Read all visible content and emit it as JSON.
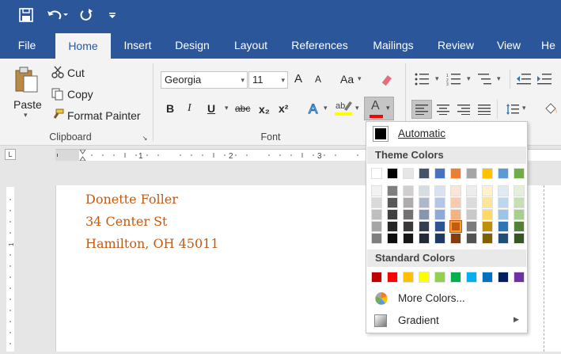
{
  "qat": {
    "icons": [
      "save-icon",
      "undo-icon",
      "redo-icon",
      "customize-icon"
    ]
  },
  "tabs": [
    {
      "label": "File"
    },
    {
      "label": "Home"
    },
    {
      "label": "Insert"
    },
    {
      "label": "Design"
    },
    {
      "label": "Layout"
    },
    {
      "label": "References"
    },
    {
      "label": "Mailings"
    },
    {
      "label": "Review"
    },
    {
      "label": "View"
    },
    {
      "label": "He"
    }
  ],
  "clipboard": {
    "paste": "Paste",
    "cut": "Cut",
    "copy": "Copy",
    "format_painter": "Format Painter",
    "group_label": "Clipboard"
  },
  "font": {
    "name": "Georgia",
    "size": "11",
    "group_label": "Font",
    "change_case": "Aa",
    "bold": "B",
    "italic": "I",
    "underline": "U",
    "strike": "abc",
    "subscript": "x₂",
    "superscript": "x²",
    "font_color_letter": "A",
    "grow": "A",
    "shrink": "A"
  },
  "paragraph": {
    "group_label": ""
  },
  "document": {
    "lines": [
      "Donette Foller",
      "34 Center St",
      "Hamilton, OH 45011"
    ]
  },
  "color_menu": {
    "automatic": "Automatic",
    "theme_header": "Theme Colors",
    "standard_header": "Standard Colors",
    "more_colors": "More Colors...",
    "gradient": "Gradient",
    "theme_top": [
      "#ffffff",
      "#000000",
      "#e7e6e6",
      "#44546a",
      "#4472c4",
      "#ed7d31",
      "#a5a5a5",
      "#ffc000",
      "#5b9bd5",
      "#70ad47"
    ],
    "theme_shades": [
      [
        "#f2f2f2",
        "#d9d9d9",
        "#bfbfbf",
        "#a6a6a6",
        "#7f7f7f"
      ],
      [
        "#7f7f7f",
        "#595959",
        "#404040",
        "#262626",
        "#0d0d0d"
      ],
      [
        "#d0cece",
        "#aeabab",
        "#767171",
        "#3a3838",
        "#171616"
      ],
      [
        "#d6dce4",
        "#adb9ca",
        "#8497b0",
        "#333f4f",
        "#222a35"
      ],
      [
        "#d9e2f3",
        "#b4c6e7",
        "#8eaadb",
        "#2f5496",
        "#1f3864"
      ],
      [
        "#fbe5d5",
        "#f7caac",
        "#f4b183",
        "#c55a11",
        "#833c0b"
      ],
      [
        "#ededed",
        "#dbdbdb",
        "#c9c9c9",
        "#7b7b7b",
        "#525252"
      ],
      [
        "#fff2cc",
        "#fee599",
        "#ffd966",
        "#bf8f00",
        "#7f6000"
      ],
      [
        "#deebf6",
        "#bdd7ee",
        "#9dc3e6",
        "#2e75b5",
        "#1f4e79"
      ],
      [
        "#e2efd9",
        "#c5e0b3",
        "#a8d08d",
        "#538135",
        "#375623"
      ]
    ],
    "standard": [
      "#c00000",
      "#ff0000",
      "#ffc000",
      "#ffff00",
      "#92d050",
      "#00b050",
      "#00b0f0",
      "#0070c0",
      "#002060",
      "#7030a0"
    ],
    "selected": "#c55a11"
  }
}
